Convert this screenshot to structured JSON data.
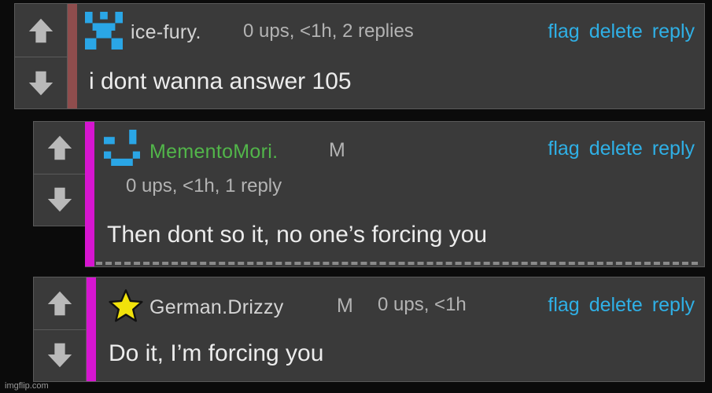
{
  "comments": [
    {
      "username": "ice-fury.",
      "meta": "0 ups, <1h, 2 replies",
      "text": "i dont wanna answer 105",
      "flag_label": "flag",
      "delete_label": "delete",
      "reply_label": "reply",
      "bar_color": "#8f4d4d"
    },
    {
      "username": "MementoMori.",
      "mod_badge": "M",
      "meta": "0 ups, <1h, 1 reply",
      "text": "Then dont so it, no one’s forcing you",
      "flag_label": "flag",
      "delete_label": "delete",
      "reply_label": "reply",
      "bar_color": "#d615d0"
    },
    {
      "username": "German.Drizzy",
      "mod_badge": "M",
      "meta": "0 ups, <1h",
      "text": "Do it, I’m forcing you",
      "flag_label": "flag",
      "delete_label": "delete",
      "reply_label": "reply",
      "bar_color": "#d615d0"
    }
  ],
  "icons": {
    "upvote": "up-arrow-icon",
    "downvote": "down-arrow-icon",
    "avatar_1": "pixel-face-avatar-icon",
    "avatar_2": "pixel-smile-avatar-icon",
    "avatar_3": "star-avatar-icon"
  },
  "colors": {
    "link": "#2fb0e6",
    "username_green": "#52b64a",
    "avatar_blue": "#2aa6e6",
    "star": "#f1e20b"
  },
  "watermark": "imgflip.com"
}
